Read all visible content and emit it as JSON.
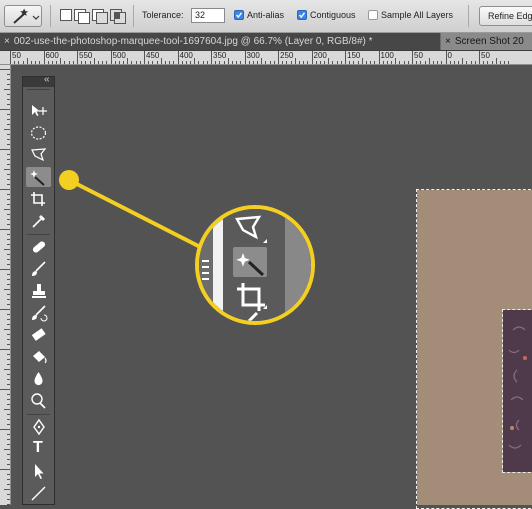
{
  "options_bar": {
    "tool_icon": "magic-wand-icon",
    "selection_modes": [
      "new-selection",
      "add-to-selection",
      "subtract-from-selection",
      "intersect-with-selection"
    ],
    "tolerance_label": "Tolerance:",
    "tolerance_value": "32",
    "anti_alias_label": "Anti-alias",
    "anti_alias_checked": true,
    "contiguous_label": "Contiguous",
    "contiguous_checked": true,
    "sample_all_layers_label": "Sample All Layers",
    "sample_all_layers_checked": false,
    "refine_edge_label": "Refine Edg"
  },
  "tabs": [
    {
      "close": "×",
      "label": "002-use-the-photoshop-marquee-tool-1697604.jpg @ 66.7% (Layer 0, RGB/8#) *",
      "active": true
    },
    {
      "close": "×",
      "label": "Screen Shot 20",
      "active": false
    }
  ],
  "ruler": {
    "labels": [
      "50",
      "600",
      "550",
      "500",
      "450",
      "400",
      "350",
      "300",
      "250",
      "200",
      "150",
      "100",
      "50",
      "0",
      "50"
    ]
  },
  "toolbar": {
    "collapse_glyph": "«",
    "tools": [
      {
        "name": "move-tool",
        "icon": "move-icon"
      },
      {
        "name": "elliptical-marquee-tool",
        "icon": "ellipse-marquee-icon"
      },
      {
        "name": "polygonal-lasso-tool",
        "icon": "polygonal-lasso-icon"
      },
      {
        "name": "magic-wand-tool",
        "icon": "magic-wand-icon"
      },
      {
        "name": "crop-tool",
        "icon": "crop-icon"
      },
      {
        "name": "eyedropper-tool",
        "icon": "eyedropper-icon"
      },
      {
        "name": "spot-healing-brush-tool",
        "icon": "bandage-icon"
      },
      {
        "name": "brush-tool",
        "icon": "brush-icon"
      },
      {
        "name": "clone-stamp-tool",
        "icon": "stamp-icon"
      },
      {
        "name": "history-brush-tool",
        "icon": "history-brush-icon"
      },
      {
        "name": "eraser-tool",
        "icon": "eraser-icon"
      },
      {
        "name": "paint-bucket-tool",
        "icon": "bucket-icon"
      },
      {
        "name": "blur-tool",
        "icon": "drop-icon"
      },
      {
        "name": "dodge-tool",
        "icon": "dodge-icon"
      },
      {
        "name": "pen-tool",
        "icon": "pen-icon"
      },
      {
        "name": "type-tool",
        "icon": "type-icon",
        "glyph": "T"
      },
      {
        "name": "path-selection-tool",
        "icon": "arrow-icon"
      },
      {
        "name": "line-tool",
        "icon": "line-icon"
      }
    ]
  },
  "callout": {
    "highlight_color": "#f2cf21",
    "tools": [
      "polygonal-lasso-icon",
      "magic-wand-icon",
      "crop-icon"
    ]
  },
  "colors": {
    "canvas_bg": "#535353",
    "document_fill": "#a48d78",
    "inner_image_fill": "#4f3a4b",
    "checkbox_on": "#3b86e3"
  }
}
